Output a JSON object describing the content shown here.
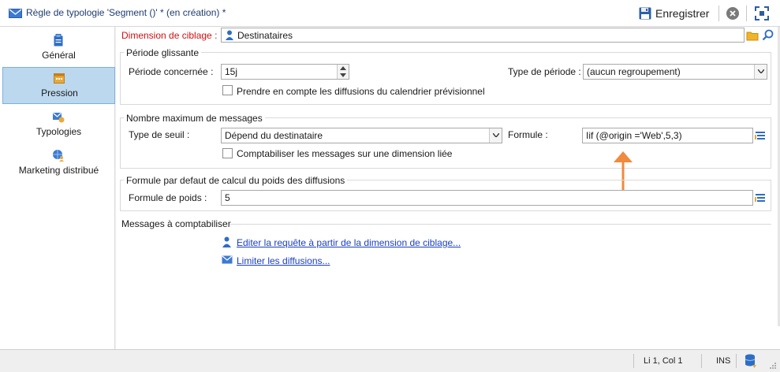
{
  "window": {
    "title": "Règle de typologie 'Segment ()' * (en création) *",
    "save_label": "Enregistrer"
  },
  "sidebar": {
    "items": [
      {
        "label": "Général",
        "icon": "clipboard-icon"
      },
      {
        "label": "Pression",
        "icon": "calendar-icon",
        "active": true
      },
      {
        "label": "Typologies",
        "icon": "typology-icon"
      },
      {
        "label": "Marketing distribué",
        "icon": "globe-user-icon"
      }
    ]
  },
  "targeting": {
    "label": "Dimension de ciblage :",
    "value": "Destinataires"
  },
  "period": {
    "group_title": "Période glissante",
    "period_label": "Période concernée :",
    "period_value": "15j",
    "type_label": "Type de période :",
    "type_value": "(aucun regroupement)",
    "calendar_checkbox_label": "Prendre en compte les diffusions du calendrier prévisionnel"
  },
  "max_messages": {
    "group_title": "Nombre maximum de messages",
    "threshold_label": "Type de seuil :",
    "threshold_value": "Dépend du destinataire",
    "formula_label": "Formule :",
    "formula_value": "Iif (@origin ='Web',5,3)",
    "linked_checkbox_label": "Comptabiliser les messages sur une dimension liée"
  },
  "weight": {
    "group_title": "Formule par defaut de calcul du poids des diffusions",
    "label": "Formule de poids :",
    "value": "5"
  },
  "messages": {
    "group_title": "Messages à comptabiliser",
    "edit_query_link": "Editer la requête à partir de la dimension de ciblage...",
    "limit_link": "Limiter les diffusions..."
  },
  "status": {
    "position": "Li 1, Col 1",
    "mode": "INS"
  },
  "colors": {
    "accent": "#f08a3c",
    "link": "#1a3fbf",
    "active_nav": "#bcd8ef",
    "required_label": "#cc1111"
  }
}
